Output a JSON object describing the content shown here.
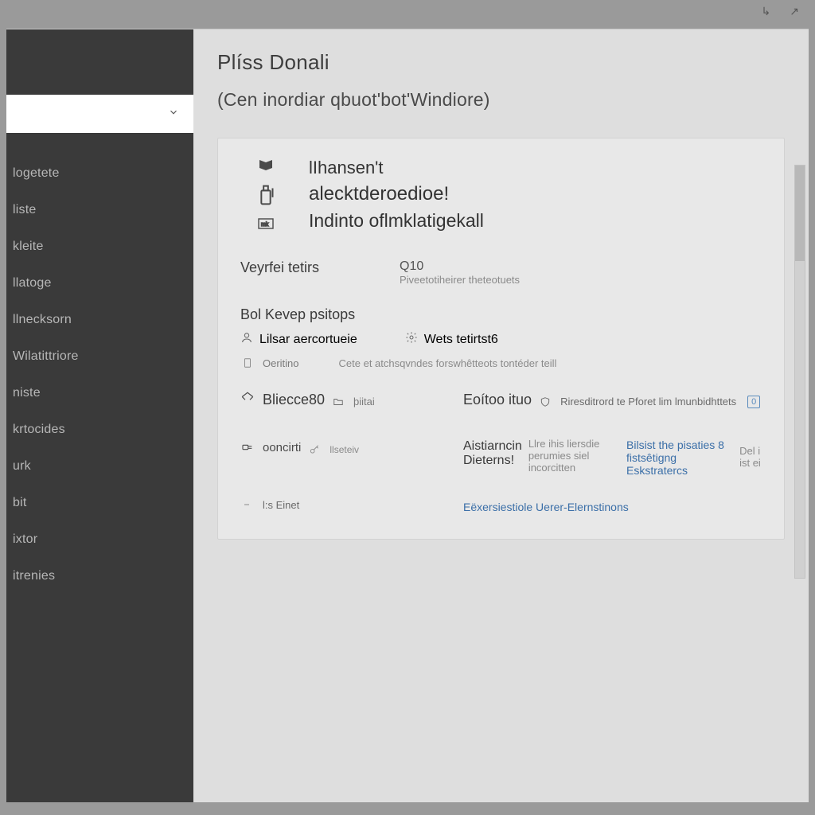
{
  "topright": {
    "a": "↳",
    "b": "↗"
  },
  "sidebar": {
    "items": [
      {
        "label": "logetete"
      },
      {
        "label": "liste"
      },
      {
        "label": "kleite"
      },
      {
        "label": "llatoge"
      },
      {
        "label": "llnecksorn"
      },
      {
        "label": "Wilatittriore"
      },
      {
        "label": "niste"
      },
      {
        "label": "krtocides"
      },
      {
        "label": "urk"
      },
      {
        "label": "bit"
      },
      {
        "label": "ixtor"
      },
      {
        "label": "itrenies"
      }
    ]
  },
  "header": {
    "title": "Plíss Donali",
    "subtitle": "(Сen inordiar qbuot'bot'Windiore)"
  },
  "hero": {
    "line1": "lIhansen't",
    "line2": "alecktderoedioe!",
    "line3": "Indinto oflmklatigekall"
  },
  "version": {
    "label": "Veyrfei tetirs",
    "value": "Q10",
    "note": "Piveetotiheirer theteotuets"
  },
  "repo": {
    "title": "Bol Kevep psitops",
    "left_icon_label": "Lilsar aercortueie",
    "right_icon_label": "Wets tetirtst6",
    "sub_icon_label": "Oeritino",
    "sub_desc": "Cete et atchsqvndes forswhêtteots tontéder teill"
  },
  "footer_section": {
    "left_title": "Bliecce80",
    "right_title": "Eoítoo ituo",
    "left_sub": "þiitai",
    "right_sub": "Riresditrord te Pforet lim lmunbidhttets",
    "badge": "0"
  },
  "advanced": {
    "title": "Aistiarncin Dieterns!",
    "left_label": "ooncirti",
    "left_sub": "llseteiv",
    "right_line1": "Llre ihis liersdie perumies siel incorcitten",
    "right_link": "Bilsist the pisaties 8 fistsêtigng Eskstratercs",
    "right_line3": "Del i ist ei"
  },
  "last": {
    "left_label": "l:s Einet",
    "right_link": "Eёxersiestiole Uerer-Elernstinons"
  }
}
